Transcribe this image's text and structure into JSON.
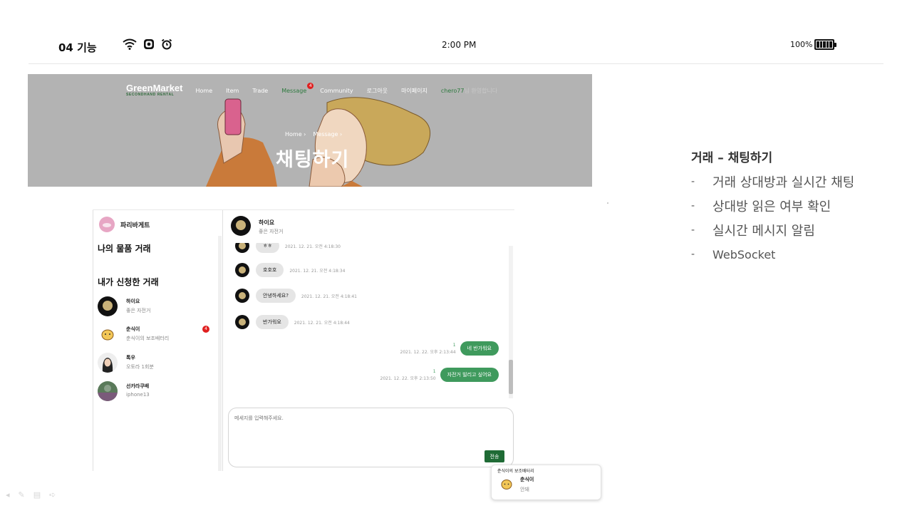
{
  "status_bar": {
    "label": "04 기능",
    "time": "2:00 PM",
    "battery": "100%",
    "icons": [
      "wifi-icon",
      "instagram-icon",
      "alarm-clock-icon",
      "battery-icon"
    ]
  },
  "hero": {
    "brand": "GreenMarket",
    "brand_sub": "SECONDHAND RENTAL",
    "nav": [
      "Home",
      "Item",
      "Trade",
      "Message",
      "Community",
      "로그아웃",
      "마이페이지"
    ],
    "message_badge": "4",
    "user": "chero77",
    "user_suffix": "님 환영합니다",
    "breadcrumb": [
      "Home",
      "Message"
    ],
    "title": "채팅하기"
  },
  "chat": {
    "me_name": "파리바게트",
    "my_items_title": "나의 물품 거래",
    "applied_title": "내가 신청한 거래",
    "partners": [
      {
        "name": "하이요",
        "item": "좋은 자전거"
      },
      {
        "name": "춘식이",
        "item": "춘식이의 보조배터리",
        "badge": "4"
      },
      {
        "name": "톡우",
        "item": "오토라 1회분"
      },
      {
        "name": "선카라쿠배",
        "item": "iphone13"
      }
    ],
    "header": {
      "name": "하이요",
      "item": "좋은 자전거"
    },
    "messages": [
      {
        "text": "ㅎㅎ",
        "time": "2021. 12. 21. 오전 4:18:30"
      },
      {
        "text": "호호호",
        "time": "2021. 12. 21. 오전 4:18:34"
      },
      {
        "text": "안녕하세요?",
        "time": "2021. 12. 21. 오전 4:18:41"
      },
      {
        "text": "반가워요",
        "time": "2021. 12. 21. 오전 4:18:44"
      },
      {
        "text": "네 반가워요",
        "time": "2021. 12. 22. 오후 2:13:44",
        "read": "1"
      },
      {
        "text": "자전거 빌리고 싶어요",
        "time": "2021. 12. 22. 오후 2:13:50",
        "read": "1"
      }
    ],
    "input_placeholder": "메세지를 입력해주세요.",
    "send_label": "전송"
  },
  "toast": {
    "title": "춘식이의 보조배터리",
    "name": "춘식이",
    "body": "안돼"
  },
  "notes": {
    "title": "거래 – 채팅하기",
    "items": [
      "거래 상대방과 실시간 채팅",
      "상대방 읽은 여부 확인",
      "실시간 메시지 알림",
      "WebSocket"
    ]
  },
  "colors": {
    "brand_green": "#2d7a3e",
    "bubble_out": "#3f9a5d",
    "send_button": "#1f6b35",
    "badge_red": "#e02020",
    "hero_bg": "#b3b3b3"
  }
}
